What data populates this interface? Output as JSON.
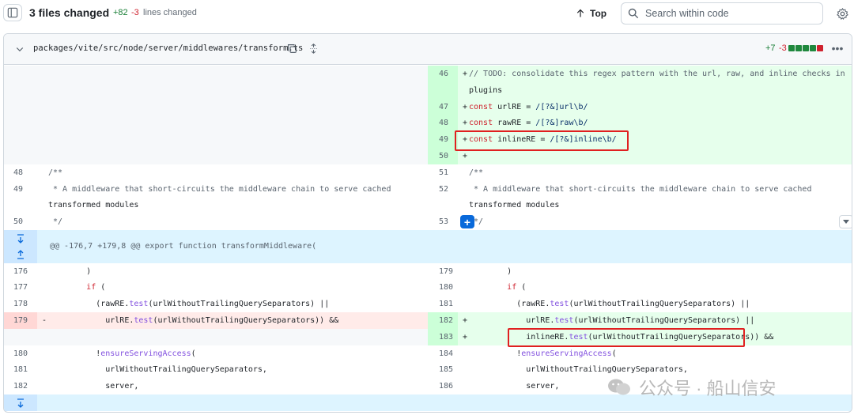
{
  "toolbar": {
    "files_changed": "3 files changed",
    "additions": "+82",
    "deletions": "-3",
    "lines_changed": "lines changed",
    "top_label": "Top",
    "search_placeholder": "Search within code"
  },
  "file": {
    "path": "packages/vite/src/node/server/middlewares/transform.ts",
    "additions": "+7",
    "deletions": "-3",
    "diffstat": [
      "add",
      "add",
      "add",
      "add",
      "del"
    ]
  },
  "colors": {
    "add": "#1f883d",
    "del": "#cf222e",
    "neutral": "#d0d7de",
    "accent": "#0969da"
  },
  "rows": [
    {
      "type": "add-right",
      "rn": "46",
      "right": "// TODO: consolidate this regex pattern with the url, raw, and inline checks in"
    },
    {
      "type": "add-right-cont",
      "right": "plugins"
    },
    {
      "type": "add-right",
      "rn": "47",
      "right": "const urlRE = /[?&]url\\b/"
    },
    {
      "type": "add-right",
      "rn": "48",
      "right": "const rawRE = /[?&]raw\\b/"
    },
    {
      "type": "add-right",
      "rn": "49",
      "right": "const inlineRE = /[?&]inline\\b/"
    },
    {
      "type": "add-right",
      "rn": "50",
      "right": ""
    },
    {
      "type": "ctx",
      "ln": "48",
      "left": "/**",
      "rn": "51",
      "right": "/**"
    },
    {
      "type": "ctx",
      "ln": "49",
      "left": " * A middleware that short-circuits the middleware chain to serve cached",
      "rn": "52",
      "right": " * A middleware that short-circuits the middleware chain to serve cached"
    },
    {
      "type": "ctx-cont",
      "left": "transformed modules",
      "right": "transformed modules"
    },
    {
      "type": "ctx",
      "ln": "50",
      "left": " */",
      "rn": "53",
      "right": " */"
    },
    {
      "type": "hunk",
      "text": "@@ -176,7 +179,8 @@ export function transformMiddleware("
    },
    {
      "type": "ctx",
      "ln": "176",
      "left": "        )",
      "rn": "179",
      "right": "        )"
    },
    {
      "type": "ctx",
      "ln": "177",
      "left": "        if (",
      "rn": "180",
      "right": "        if ("
    },
    {
      "type": "ctx",
      "ln": "178",
      "left": "          (rawRE.test(urlWithoutTrailingQuerySeparators) ||",
      "rn": "181",
      "right": "          (rawRE.test(urlWithoutTrailingQuerySeparators) ||"
    },
    {
      "type": "change",
      "ln": "179",
      "left": "            urlRE.test(urlWithoutTrailingQuerySeparators)) &&",
      "rn": "182",
      "right": "            urlRE.test(urlWithoutTrailingQuerySeparators) ||"
    },
    {
      "type": "add-right",
      "rn": "183",
      "right": "            inlineRE.test(urlWithoutTrailingQuerySeparators)) &&"
    },
    {
      "type": "ctx",
      "ln": "180",
      "left": "          !ensureServingAccess(",
      "rn": "184",
      "right": "          !ensureServingAccess("
    },
    {
      "type": "ctx",
      "ln": "181",
      "left": "            urlWithoutTrailingQuerySeparators,",
      "rn": "185",
      "right": "            urlWithoutTrailingQuerySeparators,"
    },
    {
      "type": "ctx",
      "ln": "182",
      "left": "            server,",
      "rn": "186",
      "right": "            server,"
    },
    {
      "type": "hunk-end",
      "text": ""
    }
  ],
  "markers": {
    "add": "+",
    "del": "-"
  },
  "watermark": {
    "text": "公众号 · 船山信安"
  }
}
